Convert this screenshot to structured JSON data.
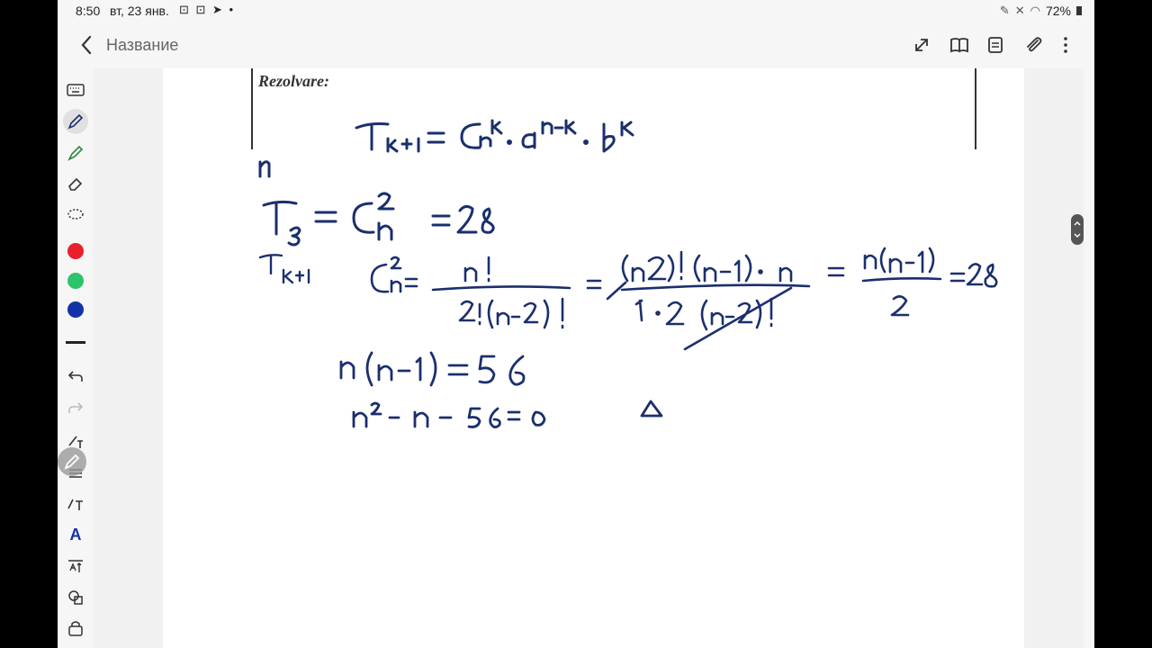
{
  "status_bar": {
    "time": "8:50",
    "date": "вт, 23 янв.",
    "battery": "72%"
  },
  "toolbar": {
    "title": "Название",
    "icons": [
      "back-arrow-icon",
      "expand-icon",
      "book-icon",
      "page-icon",
      "paperclip-icon",
      "more-icon"
    ]
  },
  "left_rail": {
    "tools": [
      "keyboard-icon",
      "pen-icon",
      "highlighter-icon",
      "eraser-icon",
      "lasso-icon"
    ],
    "colors": [
      "#e8202a",
      "#2cc46b",
      "#1233a8"
    ],
    "actions": [
      "undo-icon",
      "redo-icon",
      "text-pen-icon",
      "text-lines-icon",
      "text-format-icon",
      "handwriting-a-icon",
      "text-spacing-icon",
      "shapes-icon",
      "lock-icon"
    ]
  },
  "document": {
    "pdf_heading": "Rezolvare:",
    "ink_color": "#1b2f6e"
  }
}
